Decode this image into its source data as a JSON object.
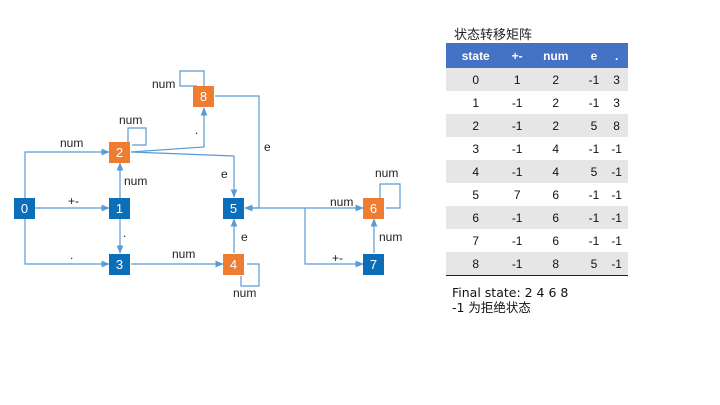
{
  "diagram": {
    "nodes": [
      {
        "id": "0",
        "label": "0",
        "color": "#0b6eb8"
      },
      {
        "id": "1",
        "label": "1",
        "color": "#0b6eb8"
      },
      {
        "id": "2",
        "label": "2",
        "color": "#ee7d31"
      },
      {
        "id": "3",
        "label": "3",
        "color": "#0b6eb8"
      },
      {
        "id": "4",
        "label": "4",
        "color": "#ee7d31"
      },
      {
        "id": "5",
        "label": "5",
        "color": "#0b6eb8"
      },
      {
        "id": "6",
        "label": "6",
        "color": "#ee7d31"
      },
      {
        "id": "7",
        "label": "7",
        "color": "#0b6eb8"
      },
      {
        "id": "8",
        "label": "8",
        "color": "#ee7d31"
      }
    ],
    "edges": [
      {
        "from": "0",
        "to": "1",
        "label": "+-"
      },
      {
        "from": "0",
        "to": "2",
        "label": "num"
      },
      {
        "from": "0",
        "to": "3",
        "label": "."
      },
      {
        "from": "1",
        "to": "2",
        "label": "num"
      },
      {
        "from": "1",
        "to": "3",
        "label": "."
      },
      {
        "from": "2",
        "to": "2",
        "label": "num"
      },
      {
        "from": "2",
        "to": "8",
        "label": "."
      },
      {
        "from": "2",
        "to": "5",
        "label": "e"
      },
      {
        "from": "3",
        "to": "4",
        "label": "num"
      },
      {
        "from": "4",
        "to": "4",
        "label": "num"
      },
      {
        "from": "4",
        "to": "5",
        "label": "e"
      },
      {
        "from": "8",
        "to": "8",
        "label": "num"
      },
      {
        "from": "8",
        "to": "5",
        "label": "e"
      },
      {
        "from": "5",
        "to": "6",
        "label": "num"
      },
      {
        "from": "5",
        "to": "7",
        "label": "+-"
      },
      {
        "from": "7",
        "to": "6",
        "label": "num"
      },
      {
        "from": "6",
        "to": "6",
        "label": "num"
      }
    ]
  },
  "table": {
    "title": "状态转移矩阵",
    "headers": [
      "state",
      "+-",
      "num",
      "e",
      "."
    ],
    "rows": [
      [
        "0",
        "1",
        "2",
        "-1",
        "3"
      ],
      [
        "1",
        "-1",
        "2",
        "-1",
        "3"
      ],
      [
        "2",
        "-1",
        "2",
        "5",
        "8"
      ],
      [
        "3",
        "-1",
        "4",
        "-1",
        "-1"
      ],
      [
        "4",
        "-1",
        "4",
        "5",
        "-1"
      ],
      [
        "5",
        "7",
        "6",
        "-1",
        "-1"
      ],
      [
        "6",
        "-1",
        "6",
        "-1",
        "-1"
      ],
      [
        "7",
        "-1",
        "6",
        "-1",
        "-1"
      ],
      [
        "8",
        "-1",
        "8",
        "5",
        "-1"
      ]
    ]
  },
  "notes": {
    "final_state": "Final state: 2 4 6 8",
    "reject": "-1 为拒绝状态"
  },
  "colors": {
    "accept_state": "#ee7d31",
    "normal_state": "#0b6eb8",
    "edge": "#5b9bd5",
    "table_header": "#4472c4",
    "table_stripe": "#e7e6e6"
  }
}
